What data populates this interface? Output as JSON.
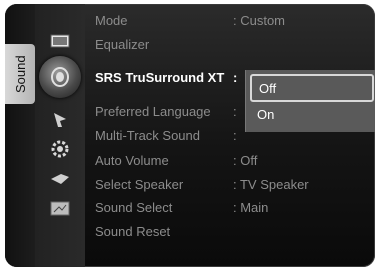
{
  "tab": {
    "label": "Sound"
  },
  "icons": [
    "picture-icon",
    "sound-icon",
    "channel-icon",
    "setup-icon",
    "input-icon",
    "support-icon"
  ],
  "menu": {
    "items": [
      {
        "label": "Mode",
        "value": ": Custom"
      },
      {
        "label": "Equalizer",
        "value": ""
      },
      {
        "label": "SRS TruSurround XT",
        "value": ":"
      },
      {
        "label": "Preferred Language",
        "value": ":"
      },
      {
        "label": "Multi-Track Sound",
        "value": ":"
      },
      {
        "label": "Auto Volume",
        "value": ": Off"
      },
      {
        "label": "Select Speaker",
        "value": ": TV Speaker"
      },
      {
        "label": "Sound Select",
        "value": ": Main"
      },
      {
        "label": "Sound Reset",
        "value": ""
      }
    ]
  },
  "dropdown": {
    "options": [
      "Off",
      "On"
    ],
    "selected": "Off"
  }
}
